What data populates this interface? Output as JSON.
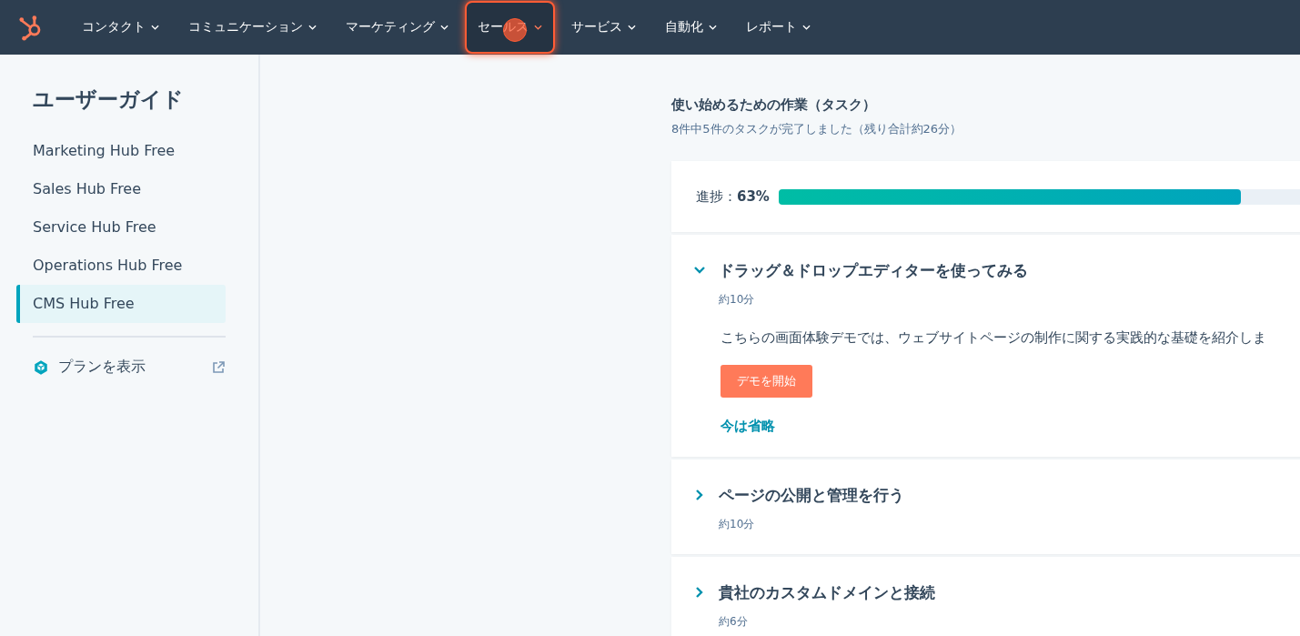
{
  "nav": [
    {
      "label": "コンタクト",
      "selected": false
    },
    {
      "label": "コミュニケーション",
      "selected": false
    },
    {
      "label": "マーケティング",
      "selected": false
    },
    {
      "label": "セールス",
      "selected": true
    },
    {
      "label": "サービス",
      "selected": false
    },
    {
      "label": "自動化",
      "selected": false
    },
    {
      "label": "レポート",
      "selected": false
    }
  ],
  "sidebar": {
    "title": "ユーザーガイド",
    "items": [
      {
        "label": "Marketing Hub Free",
        "selected": false
      },
      {
        "label": "Sales Hub Free",
        "selected": false
      },
      {
        "label": "Service Hub Free",
        "selected": false
      },
      {
        "label": "Operations Hub Free",
        "selected": false
      },
      {
        "label": "CMS Hub Free",
        "selected": true
      }
    ],
    "plan_link": "プランを表示"
  },
  "tasks_header": {
    "title": "使い始めるための作業（タスク）",
    "subtitle": "8件中5件のタスクが完了しました（残り合計約26分）"
  },
  "progress": {
    "label": "進捗：",
    "value": "63%",
    "level": 0.63
  },
  "tasks": [
    {
      "title": "ドラッグ＆ドロップエディターを使ってみる",
      "time": "約10分",
      "expanded": true,
      "description": "こちらの画面体験デモでは、ウェブサイトページの制作に関する実践的な基礎を紹介しま",
      "primary_button": "デモを開始",
      "skip_link": "今は省略"
    },
    {
      "title": "ページの公開と管理を行う",
      "time": "約10分",
      "expanded": false
    },
    {
      "title": "貴社のカスタムドメインと接続",
      "time": "約6分",
      "expanded": false
    }
  ]
}
